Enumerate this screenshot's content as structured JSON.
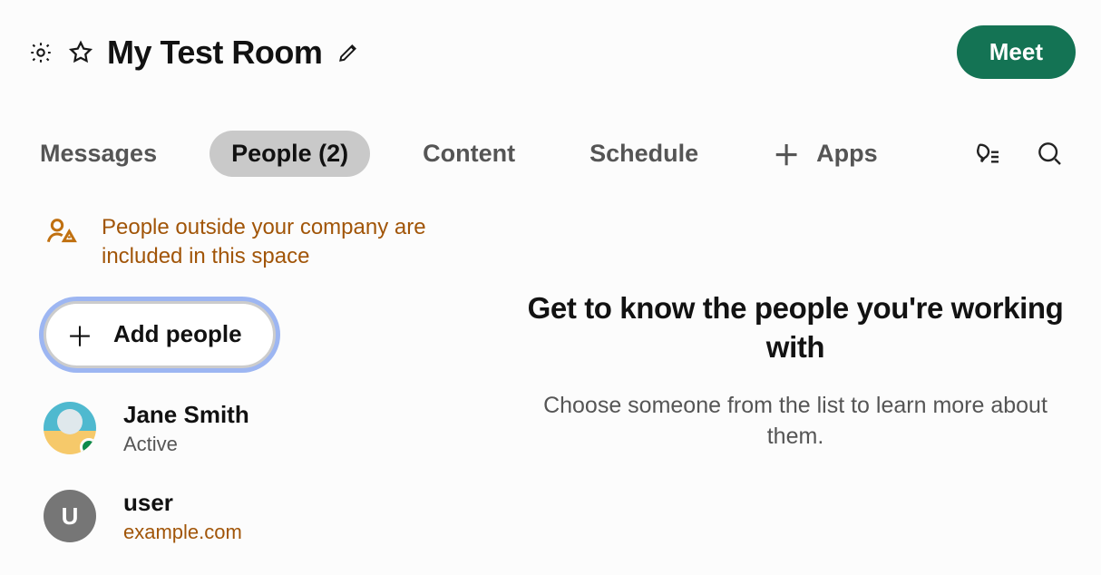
{
  "header": {
    "title": "My Test Room",
    "meet_label": "Meet"
  },
  "tabs": {
    "messages": "Messages",
    "people": "People (2)",
    "content": "Content",
    "schedule": "Schedule",
    "apps": "Apps"
  },
  "warning": {
    "text": "People outside your company are included in this space"
  },
  "add_people": {
    "label": "Add people"
  },
  "people_list": [
    {
      "name": "Jane Smith",
      "sub": "Active",
      "initial": "",
      "external": false
    },
    {
      "name": "user",
      "sub": "example.com",
      "initial": "U",
      "external": true
    }
  ],
  "right_panel": {
    "title": "Get to know the people you're working with",
    "subtitle": "Choose someone from the list to learn more about them."
  }
}
